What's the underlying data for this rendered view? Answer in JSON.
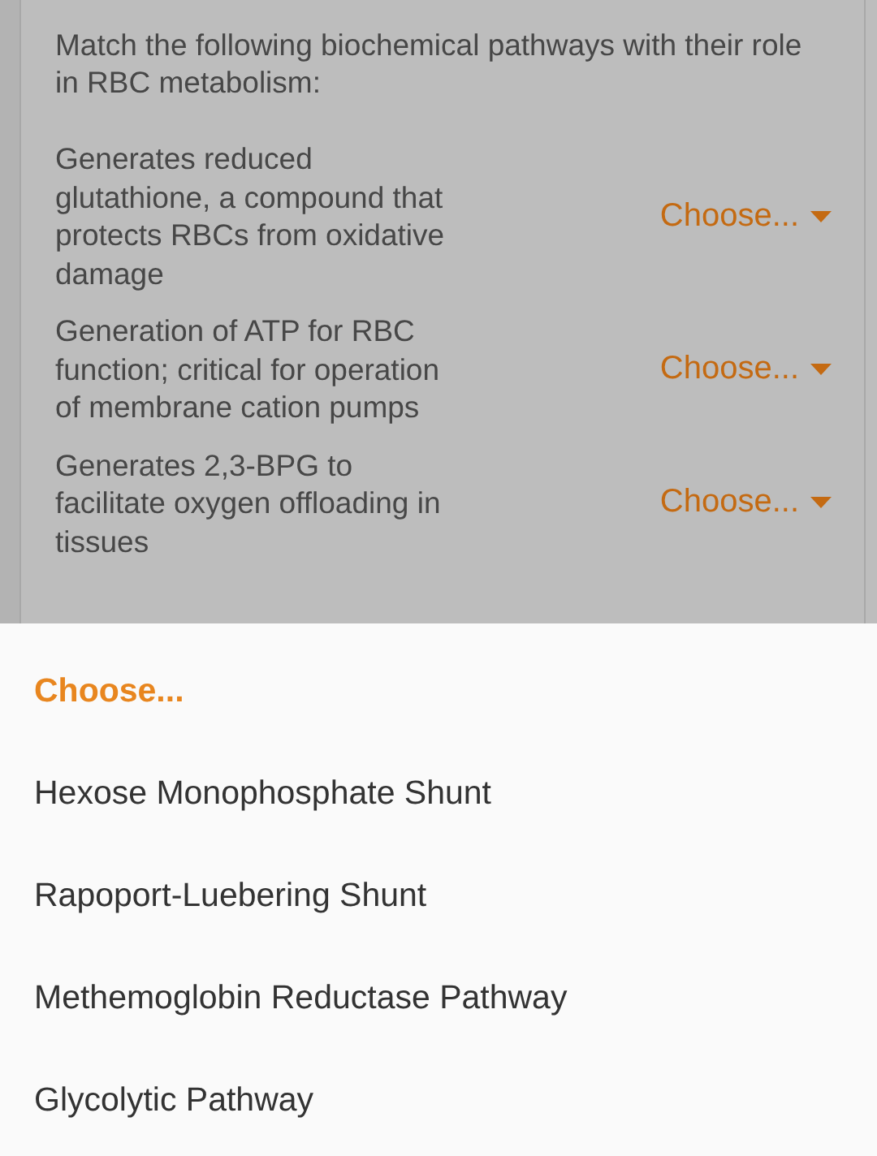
{
  "question": {
    "prompt": "Match the following biochemical pathways with their role in RBC metabolism:",
    "items": [
      {
        "text": "Generates reduced glutathione, a compound that protects RBCs from oxidative damage",
        "choice": "Choose..."
      },
      {
        "text": "Generation of ATP for RBC function; critical for operation of membrane cation pumps",
        "choice": "Choose..."
      },
      {
        "text": "Generates 2,3-BPG to facilitate oxygen offloading in tissues",
        "choice": "Choose..."
      }
    ]
  },
  "dropdown": {
    "options": [
      {
        "label": "Choose...",
        "selected": true
      },
      {
        "label": "Hexose Monophosphate Shunt",
        "selected": false
      },
      {
        "label": "Rapoport-Luebering Shunt",
        "selected": false
      },
      {
        "label": "Methemoglobin Reductase Pathway",
        "selected": false
      },
      {
        "label": "Glycolytic Pathway",
        "selected": false
      }
    ]
  }
}
